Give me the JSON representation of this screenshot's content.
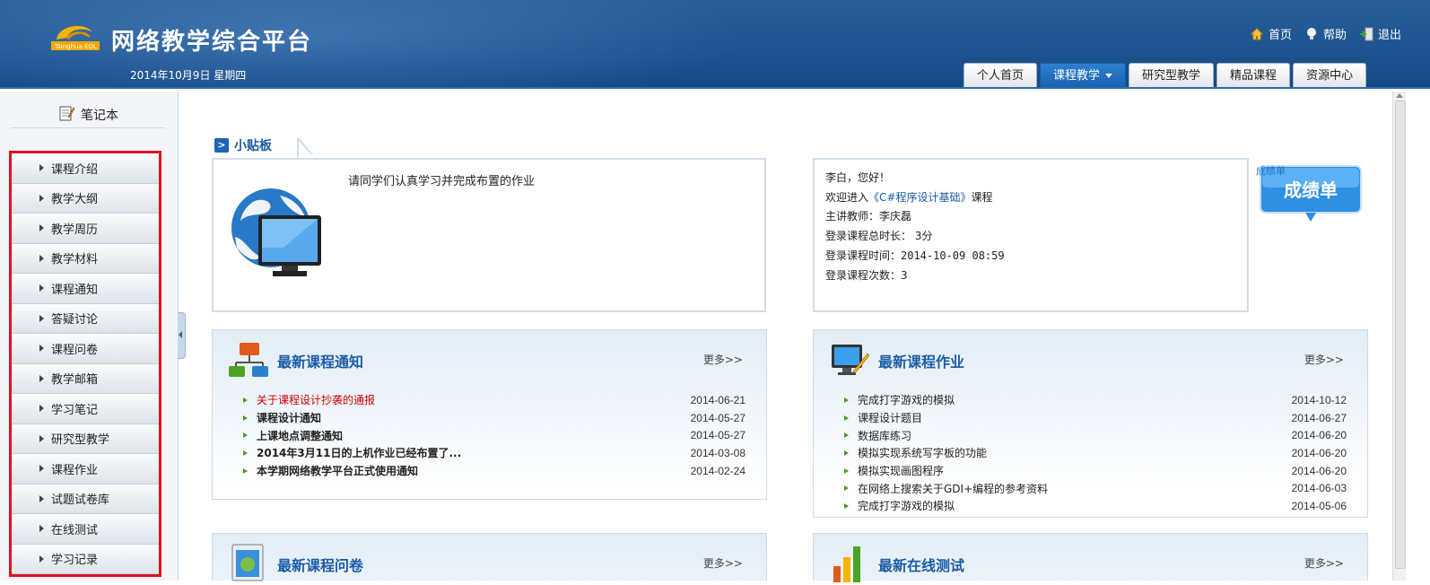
{
  "header": {
    "title": "网络教学综合平台",
    "logo_text": "Tsinghua EOL",
    "date": "2014年10月9日 星期四",
    "links": [
      {
        "label": "首页",
        "icon": "home-icon"
      },
      {
        "label": "帮助",
        "icon": "help-bulb-icon"
      },
      {
        "label": "退出",
        "icon": "logout-icon"
      }
    ],
    "tabs": [
      {
        "label": "个人首页",
        "active": false
      },
      {
        "label": "课程教学",
        "active": true
      },
      {
        "label": "研究型教学",
        "active": false
      },
      {
        "label": "精品课程",
        "active": false
      },
      {
        "label": "资源中心",
        "active": false
      }
    ]
  },
  "sidebar": {
    "notebook_label": "笔记本",
    "items": [
      {
        "label": "课程介绍"
      },
      {
        "label": "教学大纲"
      },
      {
        "label": "教学周历"
      },
      {
        "label": "教学材料"
      },
      {
        "label": "课程通知"
      },
      {
        "label": "答疑讨论"
      },
      {
        "label": "课程问卷"
      },
      {
        "label": "教学邮箱"
      },
      {
        "label": "学习笔记"
      },
      {
        "label": "研究型教学"
      },
      {
        "label": "课程作业"
      },
      {
        "label": "试题试卷库"
      },
      {
        "label": "在线测试"
      },
      {
        "label": "学习记录"
      }
    ]
  },
  "tip_board": {
    "title": "小贴板",
    "message": "请同学们认真学习并完成布置的作业"
  },
  "info": {
    "greeting": "李白，您好！",
    "welcome_prefix": "欢迎进入",
    "course_name": "《C#程序设计基础》",
    "welcome_suffix": "课程",
    "teacher": "主讲教师：李庆磊",
    "duration": "登录课程总时长： 3分",
    "login_time": "登录课程时间：2014-10-09 08:59",
    "login_count": "登录课程次数：3"
  },
  "grade": {
    "small_label": "成绩单",
    "button_label": "成绩单"
  },
  "notices": {
    "title": "最新课程通知",
    "more": "更多>>",
    "rows": [
      {
        "title": "关于课程设计抄袭的通报",
        "date": "2014-06-21",
        "style": "red"
      },
      {
        "title": "课程设计通知",
        "date": "2014-05-27",
        "style": "bold"
      },
      {
        "title": "上课地点调整通知",
        "date": "2014-05-27",
        "style": "bold"
      },
      {
        "title": "2014年3月11日的上机作业已经布置了...",
        "date": "2014-03-08",
        "style": "bold"
      },
      {
        "title": "本学期网络教学平台正式使用通知",
        "date": "2014-02-24",
        "style": "bold"
      }
    ]
  },
  "homework": {
    "title": "最新课程作业",
    "more": "更多>>",
    "rows": [
      {
        "title": "完成打字游戏的模拟",
        "date": "2014-10-12"
      },
      {
        "title": "课程设计题目",
        "date": "2014-06-27"
      },
      {
        "title": "数据库练习",
        "date": "2014-06-20"
      },
      {
        "title": "模拟实现系统写字板的功能",
        "date": "2014-06-20"
      },
      {
        "title": "模拟实现画图程序",
        "date": "2014-06-20"
      },
      {
        "title": "在网络上搜索关于GDI+编程的参考资料",
        "date": "2014-06-03"
      },
      {
        "title": "完成打字游戏的模拟",
        "date": "2014-05-06"
      }
    ]
  },
  "questionnaire": {
    "title": "最新课程问卷",
    "more": "更多>>"
  },
  "online_test": {
    "title": "最新在线测试",
    "more": "更多>>"
  },
  "colors": {
    "header_blue": "#1f5591",
    "link_blue": "#1b5aa5",
    "sidebar_highlight": "#e0121e",
    "notice_red": "#cc0000"
  }
}
